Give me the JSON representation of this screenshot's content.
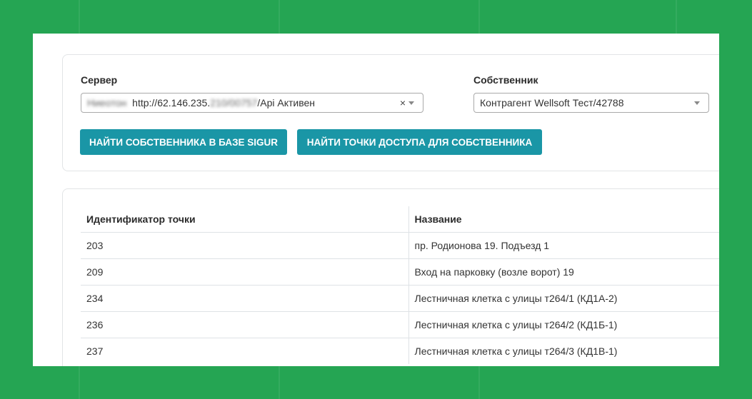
{
  "server": {
    "label": "Сервер",
    "value_blurred": "Ниеoтон",
    "value_url": "http://62.146.235.",
    "value_url_blurred": "210/00757",
    "value_suffix": "/Api Активен",
    "clear_glyph": "×"
  },
  "owner": {
    "label": "Собственник",
    "value": "Контрагент Wellsoft Тест/42788"
  },
  "buttons": {
    "find_owner": "НАЙТИ СОБСТВЕННИКА В БАЗЕ SIGUR",
    "find_points": "НАЙТИ ТОЧКИ ДОСТУПА ДЛЯ СОБСТВЕННИКА"
  },
  "table": {
    "headers": [
      "Идентификатор точки",
      "Название"
    ],
    "rows": [
      [
        "203",
        "пр. Родионова 19. Подъезд 1"
      ],
      [
        "209",
        "Вход на парковку (возле ворот) 19"
      ],
      [
        "234",
        "Лестничная клетка с улицы т264/1 (КД1А-2)"
      ],
      [
        "236",
        "Лестничная клетка с улицы т264/2 (КД1Б-1)"
      ],
      [
        "237",
        "Лестничная клетка с улицы т264/3 (КД1В-1)"
      ]
    ]
  },
  "colors": {
    "background": "#25a553",
    "button": "#1a96a6"
  }
}
